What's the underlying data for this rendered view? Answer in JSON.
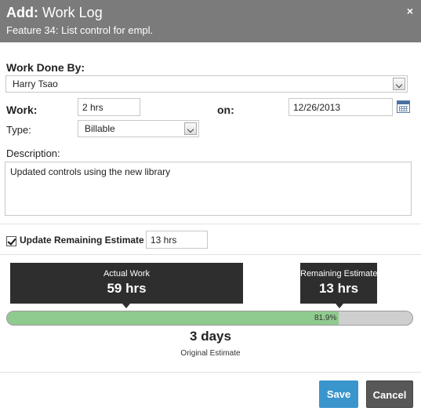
{
  "dialog": {
    "title_prefix": "Add:",
    "title": "Work Log",
    "subtitle": "Feature 34: List control for empl.",
    "close_icon": "×"
  },
  "form": {
    "work_done_by_label": "Work Done By:",
    "work_done_by_value": "Harry Tsao",
    "work_label": "Work:",
    "work_value": "2 hrs",
    "on_label": "on:",
    "date_value": "12/26/2013",
    "type_label": "Type:",
    "type_value": "Billable",
    "description_label": "Description:",
    "description_value": "Updated controls using the new library",
    "update_estimate_label": "Update Remaining Estimate",
    "update_estimate_checked": true,
    "remaining_estimate_value": "13 hrs"
  },
  "summary": {
    "actual_work_label": "Actual Work",
    "actual_work_value": "59 hrs",
    "remaining_estimate_label": "Remaining Estimate",
    "remaining_estimate_value": "13 hrs",
    "progress_percent_label": "81.9%",
    "progress_fraction": 0.819,
    "original_estimate_value": "3 days",
    "original_estimate_label": "Original Estimate"
  },
  "footer": {
    "save_label": "Save",
    "cancel_label": "Cancel"
  },
  "colors": {
    "header_bg": "#7b7b7b",
    "progress_fill": "#8fca8f",
    "save_button": "#3a95cc",
    "cancel_button": "#585858"
  }
}
